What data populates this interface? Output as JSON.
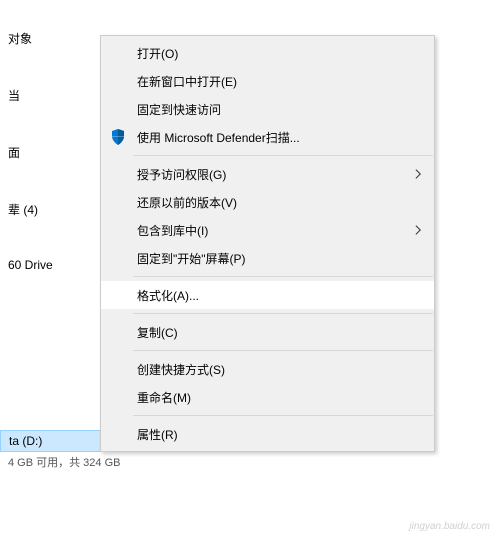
{
  "sidebar": {
    "items": [
      {
        "label": "对象"
      },
      {
        "label": "当"
      },
      {
        "label": "面"
      },
      {
        "label": "辈 (4)"
      },
      {
        "label": "60 Drive"
      }
    ]
  },
  "drive": {
    "name": "ta (D:)",
    "info": "4 GB 可用，共 324 GB"
  },
  "context_menu": {
    "groups": [
      [
        {
          "label": "打开(O)",
          "has_submenu": false,
          "icon": null
        },
        {
          "label": "在新窗口中打开(E)",
          "has_submenu": false,
          "icon": null
        },
        {
          "label": "固定到快速访问",
          "has_submenu": false,
          "icon": null
        },
        {
          "label": "使用 Microsoft Defender扫描...",
          "has_submenu": false,
          "icon": "shield"
        }
      ],
      [
        {
          "label": "授予访问权限(G)",
          "has_submenu": true,
          "icon": null
        },
        {
          "label": "还原以前的版本(V)",
          "has_submenu": false,
          "icon": null
        },
        {
          "label": "包含到库中(I)",
          "has_submenu": true,
          "icon": null
        },
        {
          "label": "固定到\"开始\"屏幕(P)",
          "has_submenu": false,
          "icon": null
        }
      ],
      [
        {
          "label": "格式化(A)...",
          "has_submenu": false,
          "icon": null,
          "highlighted": true
        }
      ],
      [
        {
          "label": "复制(C)",
          "has_submenu": false,
          "icon": null
        }
      ],
      [
        {
          "label": "创建快捷方式(S)",
          "has_submenu": false,
          "icon": null
        },
        {
          "label": "重命名(M)",
          "has_submenu": false,
          "icon": null
        }
      ],
      [
        {
          "label": "属性(R)",
          "has_submenu": false,
          "icon": null
        }
      ]
    ]
  },
  "watermark": "jingyan.baidu.com"
}
